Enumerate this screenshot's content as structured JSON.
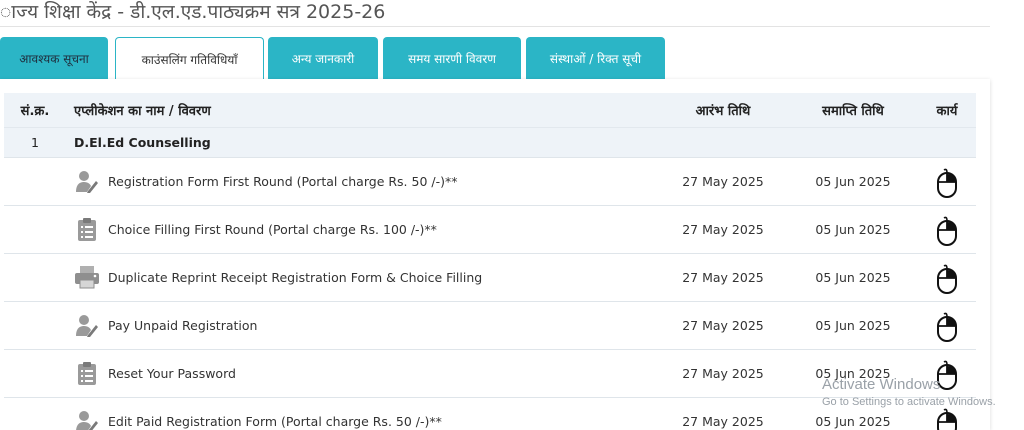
{
  "header": {
    "title": "ाज्य शिक्षा केंद्र - डी.एल.एड.पाठ्यक्रम सत्र 2025-26"
  },
  "tabs": [
    {
      "label": "आवश्यक सूचना"
    },
    {
      "label": "काउंसलिंग गतिविधियाँ"
    },
    {
      "label": "अन्य जानकारी"
    },
    {
      "label": "समय सारणी विवरण"
    },
    {
      "label": "संस्थाओं / रिक्त सूची"
    }
  ],
  "table": {
    "headers": {
      "no": "सं.क्र.",
      "name": "एप्लीकेशन का नाम / विवरण",
      "start": "आरंभ तिथि",
      "end": "समाप्ति तिथि",
      "action": "कार्य"
    },
    "group": {
      "no": "1",
      "title": "D.El.Ed Counselling"
    },
    "rows": [
      {
        "icon": "user-edit-icon",
        "name": "Registration Form First Round (Portal charge Rs. 50 /-)**",
        "start": "27 May 2025",
        "end": "05 Jun 2025"
      },
      {
        "icon": "clipboard-icon",
        "name": "Choice Filling First Round (Portal charge Rs. 100 /-)**",
        "start": "27 May 2025",
        "end": "05 Jun 2025"
      },
      {
        "icon": "printer-icon",
        "name": "Duplicate Reprint Receipt Registration Form & Choice Filling",
        "start": "27 May 2025",
        "end": "05 Jun 2025"
      },
      {
        "icon": "user-edit-icon",
        "name": "Pay Unpaid Registration",
        "start": "27 May 2025",
        "end": "05 Jun 2025"
      },
      {
        "icon": "clipboard-icon",
        "name": "Reset Your Password",
        "start": "27 May 2025",
        "end": "05 Jun 2025"
      },
      {
        "icon": "user-edit-icon",
        "name": "Edit Paid Registration Form (Portal charge Rs. 50 /-)**",
        "start": "27 May 2025",
        "end": "05 Jun 2025"
      }
    ]
  },
  "watermark": {
    "line1": "Activate Windows",
    "line2": "Go to Settings to activate Windows."
  }
}
